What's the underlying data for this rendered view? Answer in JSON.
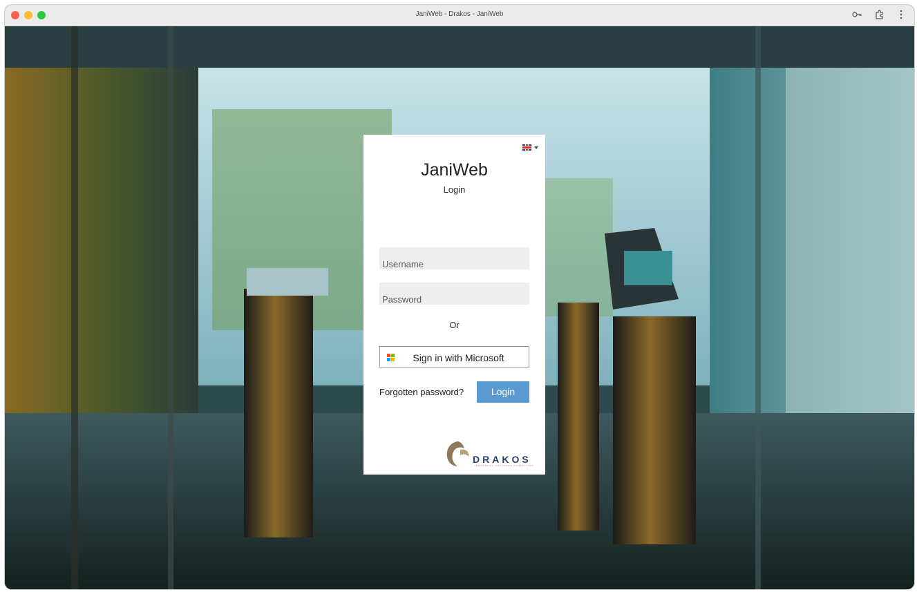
{
  "window": {
    "title": "JaniWeb - Drakos - JaniWeb",
    "icons": [
      "key-icon",
      "extension-icon",
      "more-vertical-icon"
    ]
  },
  "login": {
    "language_flag": "uk-flag-icon",
    "app_title": "JaniWeb",
    "subtitle": "Login",
    "username_placeholder": "Username",
    "password_placeholder": "Password",
    "or_label": "Or",
    "microsoft_button": "Sign in with Microsoft",
    "forgot_link": "Forgotten password?",
    "login_button": "Login"
  },
  "branding": {
    "logo_text": "DRAKOS",
    "logo_tagline": "INDUSTRIAL SOFTWARE CONSULTING"
  },
  "colors": {
    "login_button": "#5b9ad1",
    "logo_text": "#2c3e66",
    "microsoft_red": "#f25022",
    "microsoft_green": "#7fba00",
    "microsoft_blue": "#00a4ef",
    "microsoft_yellow": "#ffb900"
  }
}
